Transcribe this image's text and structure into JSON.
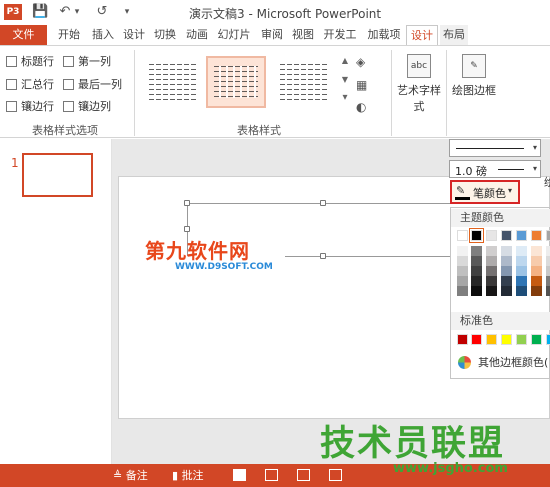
{
  "app": {
    "logo_text": "P3",
    "title": "演示文稿3 - Microsoft PowerPoint",
    "qat": {
      "save": "💾",
      "undo": "↶",
      "undo_drop": "▾",
      "redo": "↺",
      "customize": "▾"
    }
  },
  "tabs": [
    {
      "label": "文件",
      "state": "file"
    },
    {
      "label": "开始"
    },
    {
      "label": "插入"
    },
    {
      "label": "设计"
    },
    {
      "label": "切换"
    },
    {
      "label": "动画"
    },
    {
      "label": "幻灯片"
    },
    {
      "label": "审阅"
    },
    {
      "label": "视图"
    },
    {
      "label": "开发工"
    },
    {
      "label": "加载项"
    },
    {
      "label": "设计",
      "state": "active"
    },
    {
      "label": "布局",
      "state": "layout"
    }
  ],
  "ribbon": {
    "style_options": {
      "checkboxes": [
        "标题行",
        "第一列",
        "汇总行",
        "最后一列",
        "镶边行",
        "镶边列"
      ],
      "group_label": "表格样式选项"
    },
    "table_styles": {
      "group_label": "表格样式",
      "scroll_up": "▲",
      "scroll_down": "▼",
      "more": "▾"
    },
    "wordart": {
      "icon_text": "abc",
      "label": "艺术字样式"
    },
    "draw_borders": {
      "icon_text": "✎",
      "label": "绘图边框"
    }
  },
  "pen": {
    "weight_label": "1.0 磅",
    "color_button_label": "笔颜色",
    "dropdown_arrow": "▾",
    "right_fragment": "绘"
  },
  "color_menu": {
    "theme_title": "主题颜色",
    "standard_title": "标准色",
    "more_label": "其他边框颜色(",
    "theme_colors": [
      "#ffffff",
      "#000000",
      "#e7e6e6",
      "#44546a",
      "#5b9bd5",
      "#ed7d31",
      "#a5a5a5"
    ],
    "standard_colors": [
      "#c00000",
      "#ff0000",
      "#ffc000",
      "#ffff00",
      "#92d050",
      "#00b050",
      "#00b0f0"
    ]
  },
  "slide": {
    "number": "1",
    "watermark_site": "第九软件网",
    "watermark_url": "WWW.D9SOFT.COM",
    "watermark_brand": "技术员联盟",
    "watermark_domain": "www.jsgho.com"
  },
  "statusbar": {
    "notes_label": "备注",
    "comments_label": "批注",
    "notes_icon": "≜",
    "comments_icon": "▮"
  }
}
